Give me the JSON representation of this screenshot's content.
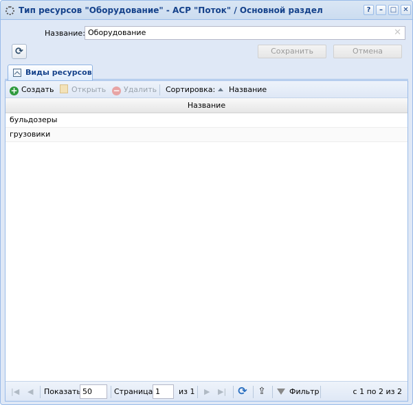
{
  "window": {
    "title": "Тип ресурсов \"Оборудование\" - АСР \"Поток\" / Основной раздел",
    "tools": [
      "?",
      "–",
      "□",
      "✕"
    ]
  },
  "form": {
    "name_label": "Название:",
    "name_value": "Оборудование",
    "save_label": "Сохранить",
    "cancel_label": "Отмена"
  },
  "tab": {
    "label": "Виды ресурсов"
  },
  "toolbar": {
    "create_label": "Создать",
    "open_label": "Открыть",
    "delete_label": "Удалить",
    "sort_label": "Сортировка:",
    "sort_field": "Название"
  },
  "grid": {
    "column_header": "Название",
    "rows": [
      "бульдозеры",
      "грузовики"
    ]
  },
  "paging": {
    "show_label": "Показать",
    "page_size": "50",
    "page_label": "Страница",
    "page_value": "1",
    "of_label": "из 1",
    "filter_label": "Фильтр",
    "summary": "с 1 по 2 из 2"
  }
}
